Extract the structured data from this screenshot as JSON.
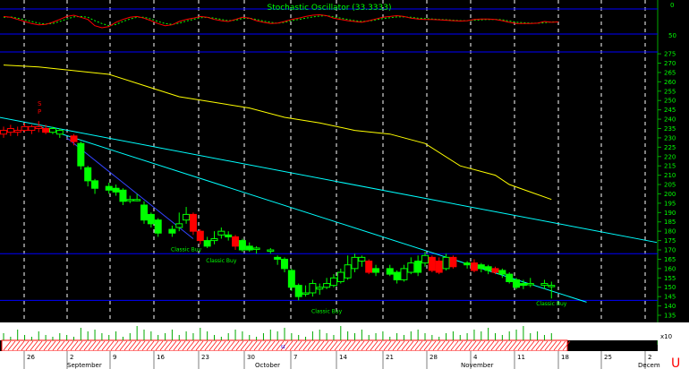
{
  "oscillator": {
    "title": "Stochastic Oscillator (33.3333)",
    "level_label": "50",
    "top_label": "0"
  },
  "colors": {
    "background": "#000000",
    "up": "#00ff00",
    "down": "#ff0000",
    "grid_v": "#ffffff",
    "blue_line": "#0000ff",
    "ma": "#ffff00",
    "trend": "#00ffff",
    "axis_panel": "#000000",
    "date_panel": "#ffffff"
  },
  "price_axis": {
    "ticks": [
      "275",
      "270",
      "265",
      "260",
      "255",
      "250",
      "245",
      "240",
      "235",
      "230",
      "225",
      "220",
      "215",
      "210",
      "205",
      "200",
      "195",
      "190",
      "185",
      "180",
      "175",
      "170",
      "165",
      "160",
      "155",
      "150",
      "145",
      "140",
      "135"
    ]
  },
  "volume_axis_label": "x10",
  "date_axis": {
    "days": [
      "26",
      "2",
      "9",
      "16",
      "23",
      "30",
      "7",
      "14",
      "21",
      "28",
      "4",
      "11",
      "18",
      "25",
      "2"
    ],
    "months": [
      "September",
      "October",
      "November",
      "Decem"
    ],
    "corner_glyph": "U"
  },
  "volume_marker": "u",
  "chart_data": {
    "type": "candlestick",
    "title": "Stochastic Oscillator (33.3333)",
    "ylim": [
      133,
      278
    ],
    "candles": [
      {
        "x": 0,
        "o": 232,
        "c": 234,
        "h": 236,
        "l": 230,
        "d": true
      },
      {
        "x": 1,
        "o": 233,
        "c": 235,
        "h": 237,
        "l": 231,
        "d": true
      },
      {
        "x": 2,
        "o": 233,
        "c": 234,
        "h": 236,
        "l": 231,
        "d": true
      },
      {
        "x": 3,
        "o": 234,
        "c": 236,
        "h": 238,
        "l": 233,
        "d": true
      },
      {
        "x": 4,
        "o": 234,
        "c": 236,
        "h": 237,
        "l": 232,
        "d": true
      },
      {
        "x": 5,
        "o": 235,
        "c": 236,
        "h": 239,
        "l": 233,
        "d": true
      },
      {
        "x": 6,
        "o": 235,
        "c": 233,
        "h": 237,
        "l": 232,
        "d": true
      },
      {
        "x": 7,
        "o": 233,
        "c": 235,
        "h": 236,
        "l": 232,
        "d": false
      },
      {
        "x": 8,
        "o": 232,
        "c": 234,
        "h": 235,
        "l": 230,
        "d": false
      },
      {
        "x": 10,
        "o": 231,
        "c": 228,
        "h": 232,
        "l": 226,
        "d": true
      },
      {
        "x": 11,
        "o": 227,
        "c": 215,
        "h": 228,
        "l": 213,
        "d": false
      },
      {
        "x": 12,
        "o": 214,
        "c": 207,
        "h": 215,
        "l": 204,
        "d": false
      },
      {
        "x": 13,
        "o": 207,
        "c": 203,
        "h": 208,
        "l": 200,
        "d": false
      },
      {
        "x": 15,
        "o": 204,
        "c": 202,
        "h": 206,
        "l": 200,
        "d": false
      },
      {
        "x": 16,
        "o": 203,
        "c": 201,
        "h": 205,
        "l": 199,
        "d": false
      },
      {
        "x": 17,
        "o": 202,
        "c": 196,
        "h": 203,
        "l": 194,
        "d": false
      },
      {
        "x": 18,
        "o": 197,
        "c": 197,
        "h": 199,
        "l": 195,
        "d": false
      },
      {
        "x": 19,
        "o": 197,
        "c": 197,
        "h": 200,
        "l": 196,
        "d": false
      },
      {
        "x": 20,
        "o": 194,
        "c": 186,
        "h": 196,
        "l": 184,
        "d": false
      },
      {
        "x": 21,
        "o": 189,
        "c": 184,
        "h": 190,
        "l": 182,
        "d": false
      },
      {
        "x": 22,
        "o": 186,
        "c": 179,
        "h": 187,
        "l": 177,
        "d": false
      },
      {
        "x": 24,
        "o": 181,
        "c": 179,
        "h": 183,
        "l": 177,
        "d": false
      },
      {
        "x": 25,
        "o": 182,
        "c": 184,
        "h": 190,
        "l": 180,
        "d": false
      },
      {
        "x": 26,
        "o": 186,
        "c": 189,
        "h": 193,
        "l": 184,
        "d": false
      },
      {
        "x": 27,
        "o": 189,
        "c": 180,
        "h": 190,
        "l": 178,
        "d": true
      },
      {
        "x": 28,
        "o": 180,
        "c": 175,
        "h": 181,
        "l": 173,
        "d": true
      },
      {
        "x": 29,
        "o": 175,
        "c": 172,
        "h": 177,
        "l": 171,
        "d": false
      },
      {
        "x": 30,
        "o": 175,
        "c": 176,
        "h": 180,
        "l": 173,
        "d": false
      },
      {
        "x": 31,
        "o": 178,
        "c": 180,
        "h": 182,
        "l": 176,
        "d": false
      },
      {
        "x": 32,
        "o": 178,
        "c": 177,
        "h": 180,
        "l": 175,
        "d": false
      },
      {
        "x": 33,
        "o": 177,
        "c": 172,
        "h": 178,
        "l": 170,
        "d": true
      },
      {
        "x": 34,
        "o": 175,
        "c": 170,
        "h": 176,
        "l": 169,
        "d": false
      },
      {
        "x": 35,
        "o": 172,
        "c": 170,
        "h": 174,
        "l": 169,
        "d": false
      },
      {
        "x": 36,
        "o": 171,
        "c": 171,
        "h": 172,
        "l": 168,
        "d": false
      },
      {
        "x": 38,
        "o": 170,
        "c": 170,
        "h": 171,
        "l": 168,
        "d": false
      },
      {
        "x": 39,
        "o": 166,
        "c": 165,
        "h": 167,
        "l": 162,
        "d": false
      },
      {
        "x": 40,
        "o": 165,
        "c": 160,
        "h": 166,
        "l": 158,
        "d": false
      },
      {
        "x": 41,
        "o": 159,
        "c": 150,
        "h": 160,
        "l": 148,
        "d": false
      },
      {
        "x": 42,
        "o": 151,
        "c": 145,
        "h": 152,
        "l": 143,
        "d": false
      },
      {
        "x": 43,
        "o": 147,
        "c": 147,
        "h": 151,
        "l": 145,
        "d": false
      },
      {
        "x": 44,
        "o": 147,
        "c": 152,
        "h": 154,
        "l": 145,
        "d": false
      },
      {
        "x": 45,
        "o": 149,
        "c": 150,
        "h": 152,
        "l": 146,
        "d": false
      },
      {
        "x": 46,
        "o": 150,
        "c": 152,
        "h": 155,
        "l": 149,
        "d": false
      },
      {
        "x": 47,
        "o": 151,
        "c": 155,
        "h": 157,
        "l": 150,
        "d": false
      },
      {
        "x": 48,
        "o": 153,
        "c": 158,
        "h": 160,
        "l": 152,
        "d": false
      },
      {
        "x": 49,
        "o": 155,
        "c": 162,
        "h": 167,
        "l": 154,
        "d": false
      },
      {
        "x": 50,
        "o": 160,
        "c": 166,
        "h": 168,
        "l": 158,
        "d": false
      },
      {
        "x": 51,
        "o": 164,
        "c": 166,
        "h": 167,
        "l": 161,
        "d": false
      },
      {
        "x": 52,
        "o": 164,
        "c": 158,
        "h": 165,
        "l": 157,
        "d": true
      },
      {
        "x": 53,
        "o": 160,
        "c": 158,
        "h": 162,
        "l": 156,
        "d": false
      },
      {
        "x": 55,
        "o": 160,
        "c": 157,
        "h": 162,
        "l": 156,
        "d": false
      },
      {
        "x": 56,
        "o": 158,
        "c": 154,
        "h": 159,
        "l": 152,
        "d": false
      },
      {
        "x": 57,
        "o": 154,
        "c": 160,
        "h": 162,
        "l": 153,
        "d": false
      },
      {
        "x": 58,
        "o": 158,
        "c": 163,
        "h": 166,
        "l": 157,
        "d": false
      },
      {
        "x": 59,
        "o": 164,
        "c": 158,
        "h": 167,
        "l": 156,
        "d": false
      },
      {
        "x": 60,
        "o": 163,
        "c": 167,
        "h": 169,
        "l": 161,
        "d": false
      },
      {
        "x": 61,
        "o": 166,
        "c": 159,
        "h": 167,
        "l": 158,
        "d": true
      },
      {
        "x": 62,
        "o": 164,
        "c": 158,
        "h": 166,
        "l": 157,
        "d": true
      },
      {
        "x": 63,
        "o": 160,
        "c": 166,
        "h": 168,
        "l": 159,
        "d": false
      },
      {
        "x": 64,
        "o": 166,
        "c": 161,
        "h": 167,
        "l": 160,
        "d": true
      },
      {
        "x": 66,
        "o": 163,
        "c": 162,
        "h": 164,
        "l": 160,
        "d": false
      },
      {
        "x": 67,
        "o": 163,
        "c": 159,
        "h": 165,
        "l": 158,
        "d": true
      },
      {
        "x": 68,
        "o": 162,
        "c": 160,
        "h": 163,
        "l": 158,
        "d": false
      },
      {
        "x": 69,
        "o": 161,
        "c": 159,
        "h": 162,
        "l": 157,
        "d": false
      },
      {
        "x": 70,
        "o": 160,
        "c": 158,
        "h": 161,
        "l": 157,
        "d": true
      },
      {
        "x": 71,
        "o": 159,
        "c": 157,
        "h": 160,
        "l": 155,
        "d": false
      },
      {
        "x": 72,
        "o": 157,
        "c": 153,
        "h": 158,
        "l": 152,
        "d": false
      },
      {
        "x": 73,
        "o": 154,
        "c": 150,
        "h": 155,
        "l": 149,
        "d": false
      },
      {
        "x": 74,
        "o": 152,
        "c": 151,
        "h": 154,
        "l": 149,
        "d": false
      },
      {
        "x": 75,
        "o": 152,
        "c": 152,
        "h": 155,
        "l": 150,
        "d": false
      },
      {
        "x": 77,
        "o": 151,
        "c": 152,
        "h": 154,
        "l": 149,
        "d": false
      },
      {
        "x": 78,
        "o": 151,
        "c": 151,
        "h": 153,
        "l": 144,
        "d": false
      }
    ],
    "moving_average": [
      [
        0,
        269
      ],
      [
        5,
        268
      ],
      [
        10,
        266
      ],
      [
        15,
        264
      ],
      [
        20,
        258
      ],
      [
        25,
        252
      ],
      [
        30,
        249
      ],
      [
        35,
        246
      ],
      [
        40,
        241
      ],
      [
        45,
        238
      ],
      [
        50,
        234
      ],
      [
        55,
        232
      ],
      [
        60,
        227
      ],
      [
        65,
        215
      ],
      [
        70,
        210
      ],
      [
        72,
        205
      ],
      [
        75,
        201
      ],
      [
        78,
        197
      ]
    ],
    "trend_lines": [
      {
        "from": [
          -2,
          242
        ],
        "to": [
          93,
          174
        ]
      },
      {
        "from": [
          5,
          236
        ],
        "to": [
          83,
          142
        ]
      },
      {
        "from": [
          9,
          230
        ],
        "to": [
          27,
          176
        ]
      }
    ],
    "horizontal_levels": [
      168,
      143
    ],
    "stochastic": {
      "k": [
        62,
        60,
        55,
        50,
        45,
        42,
        43,
        48,
        55,
        62,
        65,
        60,
        55,
        40,
        35,
        38,
        48,
        55,
        60,
        62,
        58,
        52,
        45,
        40,
        42,
        50,
        55,
        58,
        62,
        60,
        55,
        52,
        50,
        55,
        60,
        58,
        52,
        48,
        45,
        46,
        50,
        55,
        58,
        62,
        65,
        66,
        64,
        58,
        55,
        52,
        50,
        48,
        52,
        56,
        60,
        62,
        64,
        62,
        58,
        56,
        55,
        55,
        54,
        53,
        52,
        51,
        52,
        55,
        56,
        56,
        55,
        52,
        48,
        45,
        45,
        45,
        46,
        50,
        48,
        49
      ],
      "d": [
        60,
        61,
        58,
        54,
        50,
        46,
        44,
        45,
        50,
        56,
        61,
        62,
        60,
        52,
        45,
        40,
        43,
        50,
        56,
        60,
        60,
        56,
        50,
        45,
        43,
        46,
        51,
        55,
        59,
        60,
        58,
        55,
        52,
        53,
        57,
        58,
        55,
        51,
        48,
        46,
        48,
        52,
        55,
        58,
        61,
        63,
        64,
        61,
        58,
        55,
        52,
        50,
        51,
        54,
        57,
        59,
        61,
        61,
        60,
        58,
        57,
        56,
        55,
        54,
        53,
        52,
        52,
        53,
        54,
        55,
        55,
        54,
        51,
        48,
        47,
        46,
        46,
        47,
        49,
        49
      ]
    },
    "annotations": [
      "Classic Buy",
      "Classic Buy",
      "Classic Buy",
      "Classic Buy"
    ],
    "volume": [
      4,
      2,
      6,
      3,
      2,
      5,
      3,
      2,
      4,
      3,
      2,
      7,
      5,
      6,
      4,
      3,
      5,
      2,
      4,
      8,
      6,
      5,
      3,
      4,
      6,
      3,
      5,
      4,
      7,
      5,
      3,
      2,
      4,
      6,
      5,
      3,
      2,
      4,
      6,
      5,
      7,
      4,
      3,
      2,
      5,
      6,
      4,
      3,
      8,
      5,
      4,
      6,
      3,
      4,
      5,
      2,
      4,
      3,
      5,
      6,
      4,
      3,
      2,
      4,
      5,
      3,
      4,
      6,
      5,
      7,
      4,
      3,
      5,
      6,
      8,
      4,
      5,
      3,
      4
    ],
    "xlabel": "",
    "ylabel": ""
  }
}
